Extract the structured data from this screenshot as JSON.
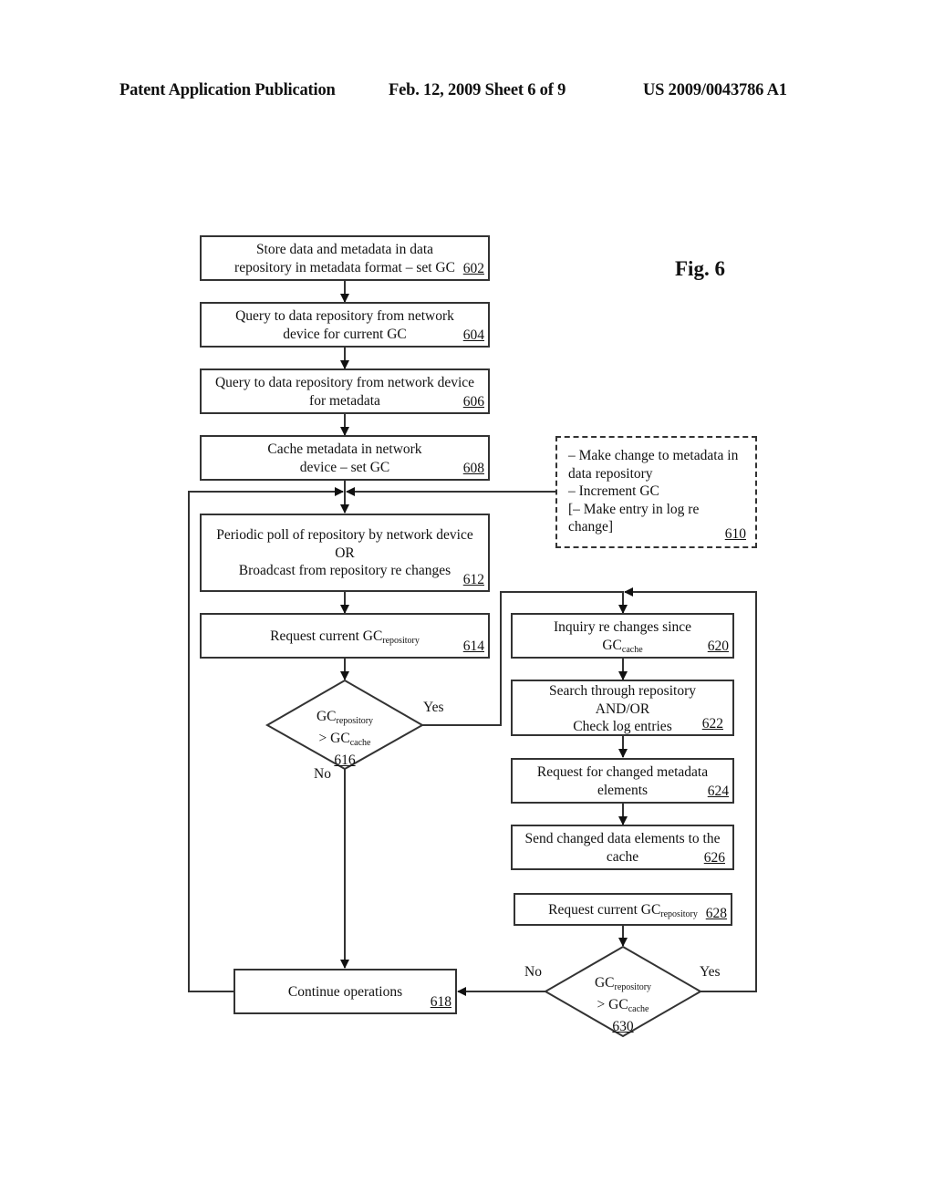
{
  "header": {
    "publication": "Patent Application Publication",
    "date_sheet": "Feb. 12, 2009   Sheet 6 of 9",
    "number": "US 2009/0043786 A1"
  },
  "figure_label": "Fig. 6",
  "steps": {
    "s602": {
      "text": "Store data and metadata in data\nrepository in metadata format – set GC",
      "ref": "602"
    },
    "s604": {
      "text": "Query to data repository from network\ndevice for current GC",
      "ref": "604"
    },
    "s606": {
      "text": "Query to data repository from network device\nfor metadata",
      "ref": "606"
    },
    "s608": {
      "text": "Cache metadata in network\ndevice – set GC",
      "ref": "608"
    },
    "s610": {
      "text": "– Make change to metadata in\ndata repository\n– Increment GC\n[– Make entry in log re\nchange]",
      "ref": "610"
    },
    "s612": {
      "text": "Periodic poll of repository by network device\nOR\nBroadcast from repository re changes",
      "ref": "612"
    },
    "s614": {
      "text": "Request current GC",
      "sub": "repository",
      "ref": "614"
    },
    "s616": {
      "line1": "GC",
      "sub1": "repository",
      "line2": "> GC",
      "sub2": "cache",
      "ref": "616"
    },
    "s618": {
      "text": "Continue operations",
      "ref": "618"
    },
    "s620": {
      "text1": "Inquiry re changes since",
      "text2": "GC",
      "sub": "cache",
      "ref": "620"
    },
    "s622": {
      "text": "Search through repository\nAND/OR\nCheck log entries",
      "ref": "622"
    },
    "s624": {
      "text": "Request for changed metadata\nelements",
      "ref": "624"
    },
    "s626": {
      "text": "Send changed data elements to the\ncache",
      "ref": "626"
    },
    "s628": {
      "text": "Request current GC",
      "sub": "repository",
      "ref": "628"
    },
    "s630": {
      "line1": "GC",
      "sub1": "repository",
      "line2": "> GC",
      "sub2": "cache",
      "ref": "630"
    }
  },
  "branch_labels": {
    "d616_yes": "Yes",
    "d616_no": "No",
    "d630_yes": "Yes",
    "d630_no": "No"
  }
}
